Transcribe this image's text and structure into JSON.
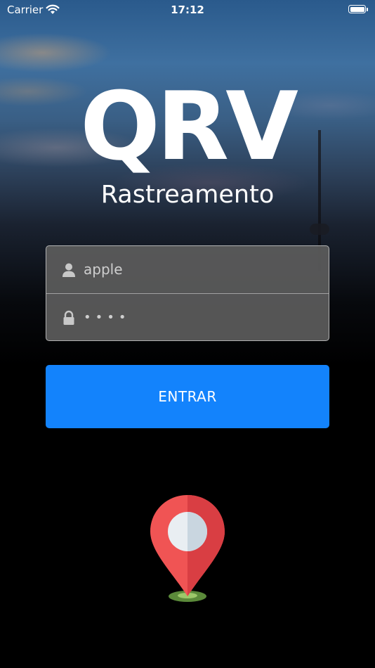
{
  "status_bar": {
    "carrier": "Carrier",
    "time": "17:12"
  },
  "app": {
    "logo": "QRV",
    "subtitle": "Rastreamento"
  },
  "login": {
    "username_value": "apple",
    "password_masked": "••••",
    "submit_label": "ENTRAR"
  },
  "colors": {
    "button": "#1383fc",
    "pin_red": "#f05454",
    "pin_ground": "#6aa84f"
  },
  "icons": [
    "wifi-icon",
    "battery-icon",
    "user-icon",
    "lock-icon",
    "location-pin-icon"
  ]
}
